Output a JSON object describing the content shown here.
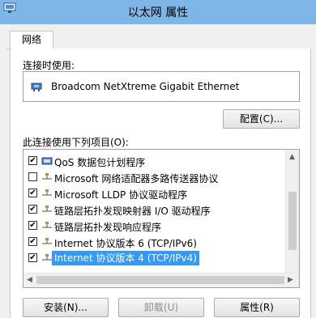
{
  "window": {
    "title": "以太网 属性"
  },
  "tabs": [
    {
      "label": "网络"
    }
  ],
  "connect_using": {
    "label": "连接时使用:",
    "adapter_name": "Broadcom NetXtreme Gigabit Ethernet",
    "configure_button": "配置(C)..."
  },
  "items_section": {
    "label": "此连接使用下列项目(O):",
    "items": [
      {
        "label": "QoS 数据包计划程序",
        "checked": true,
        "icon": "qos-service-icon"
      },
      {
        "label": "Microsoft 网络适配器多路传送器协议",
        "checked": false,
        "icon": "protocol-icon"
      },
      {
        "label": "Microsoft LLDP 协议驱动程序",
        "checked": true,
        "icon": "protocol-icon"
      },
      {
        "label": "链路层拓扑发现映射器 I/O 驱动程序",
        "checked": true,
        "icon": "protocol-icon"
      },
      {
        "label": "链路层拓扑发现响应程序",
        "checked": true,
        "icon": "protocol-icon"
      },
      {
        "label": "Internet 协议版本 6 (TCP/IPv6)",
        "checked": true,
        "icon": "protocol-icon"
      },
      {
        "label": "Internet 协议版本 4 (TCP/IPv4)",
        "checked": true,
        "icon": "protocol-icon",
        "selected": true
      }
    ]
  },
  "buttons": {
    "install": "安装(N)...",
    "uninstall": "卸载(U)",
    "properties": "属性(R)"
  },
  "colors": {
    "titlebar": "#7fb6e8",
    "selection": "#3399ff"
  }
}
